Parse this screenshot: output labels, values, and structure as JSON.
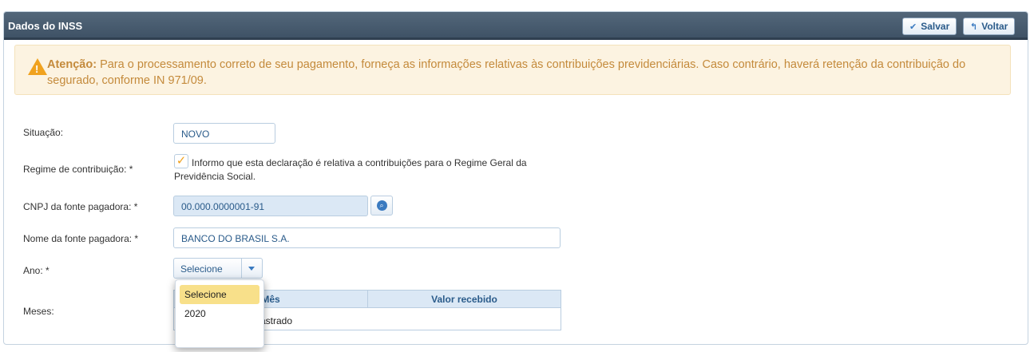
{
  "header": {
    "title": "Dados do INSS",
    "save_label": "Salvar",
    "back_label": "Voltar"
  },
  "alert": {
    "strong": "Atenção:",
    "text": " Para o processamento correto de seu pagamento, forneça as informações relativas às contribuições previdenciárias. Caso contrário, haverá retenção da contribuição do segurado, conforme IN 971/09."
  },
  "form": {
    "situacao_label": "Situação:",
    "situacao_value": "NOVO",
    "regime_label": "Regime de contribuição: *",
    "regime_checkbox_text": "Informo que esta declaração é relativa a contribuições para o Regime Geral da Previdência Social.",
    "regime_checked": true,
    "cnpj_label": "CNPJ da fonte pagadora: *",
    "cnpj_value": "00.000.0000001-91",
    "nome_label": "Nome da fonte pagadora: *",
    "nome_value": "BANCO DO BRASIL S.A.",
    "ano_label": "Ano: *",
    "ano_value": "Selecione",
    "meses_label": "Meses:"
  },
  "meses_table": {
    "columns": [
      "Mês",
      "Valor recebido"
    ],
    "empty_text": "astrado"
  },
  "ano_dropdown": {
    "options": [
      "Selecione",
      "2020"
    ],
    "highlighted": "Selecione"
  },
  "colors": {
    "header_bg": "#4a5e72",
    "accent": "#2a5b8a",
    "warning": "#f0a21f",
    "alert_bg": "#fcf3e1",
    "highlight": "#f8e08a"
  }
}
